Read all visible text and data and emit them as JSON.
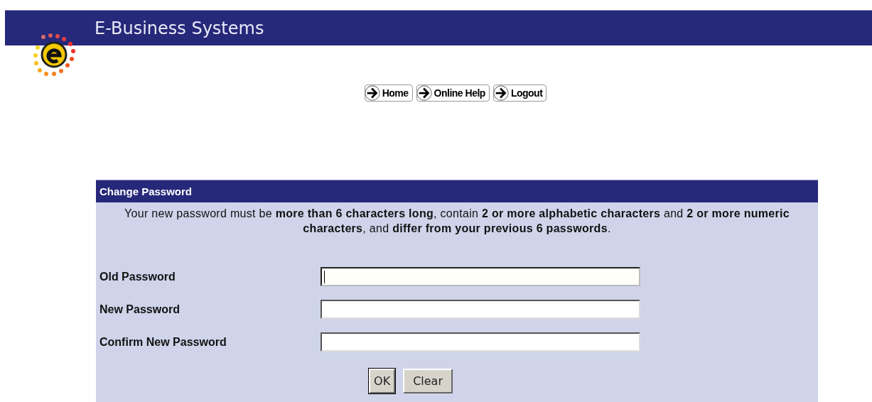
{
  "header": {
    "title": "E-Business Systems"
  },
  "nav": [
    {
      "label": "Home"
    },
    {
      "label": "Online Help"
    },
    {
      "label": "Logout"
    }
  ],
  "panel": {
    "title": "Change Password",
    "note": "Your new password must be **more than 6 characters long**, contain **2 or more alphabetic characters** and **2 or more numeric characters**, and **differ from your previous 6 passwords**.",
    "fields": [
      {
        "label": "Old Password",
        "focused": true
      },
      {
        "label": "New Password",
        "focused": false
      },
      {
        "label": "Confirm New Password",
        "focused": false
      }
    ],
    "buttons": [
      {
        "label": "OK",
        "default": true
      },
      {
        "label": "Clear",
        "default": false
      }
    ]
  }
}
